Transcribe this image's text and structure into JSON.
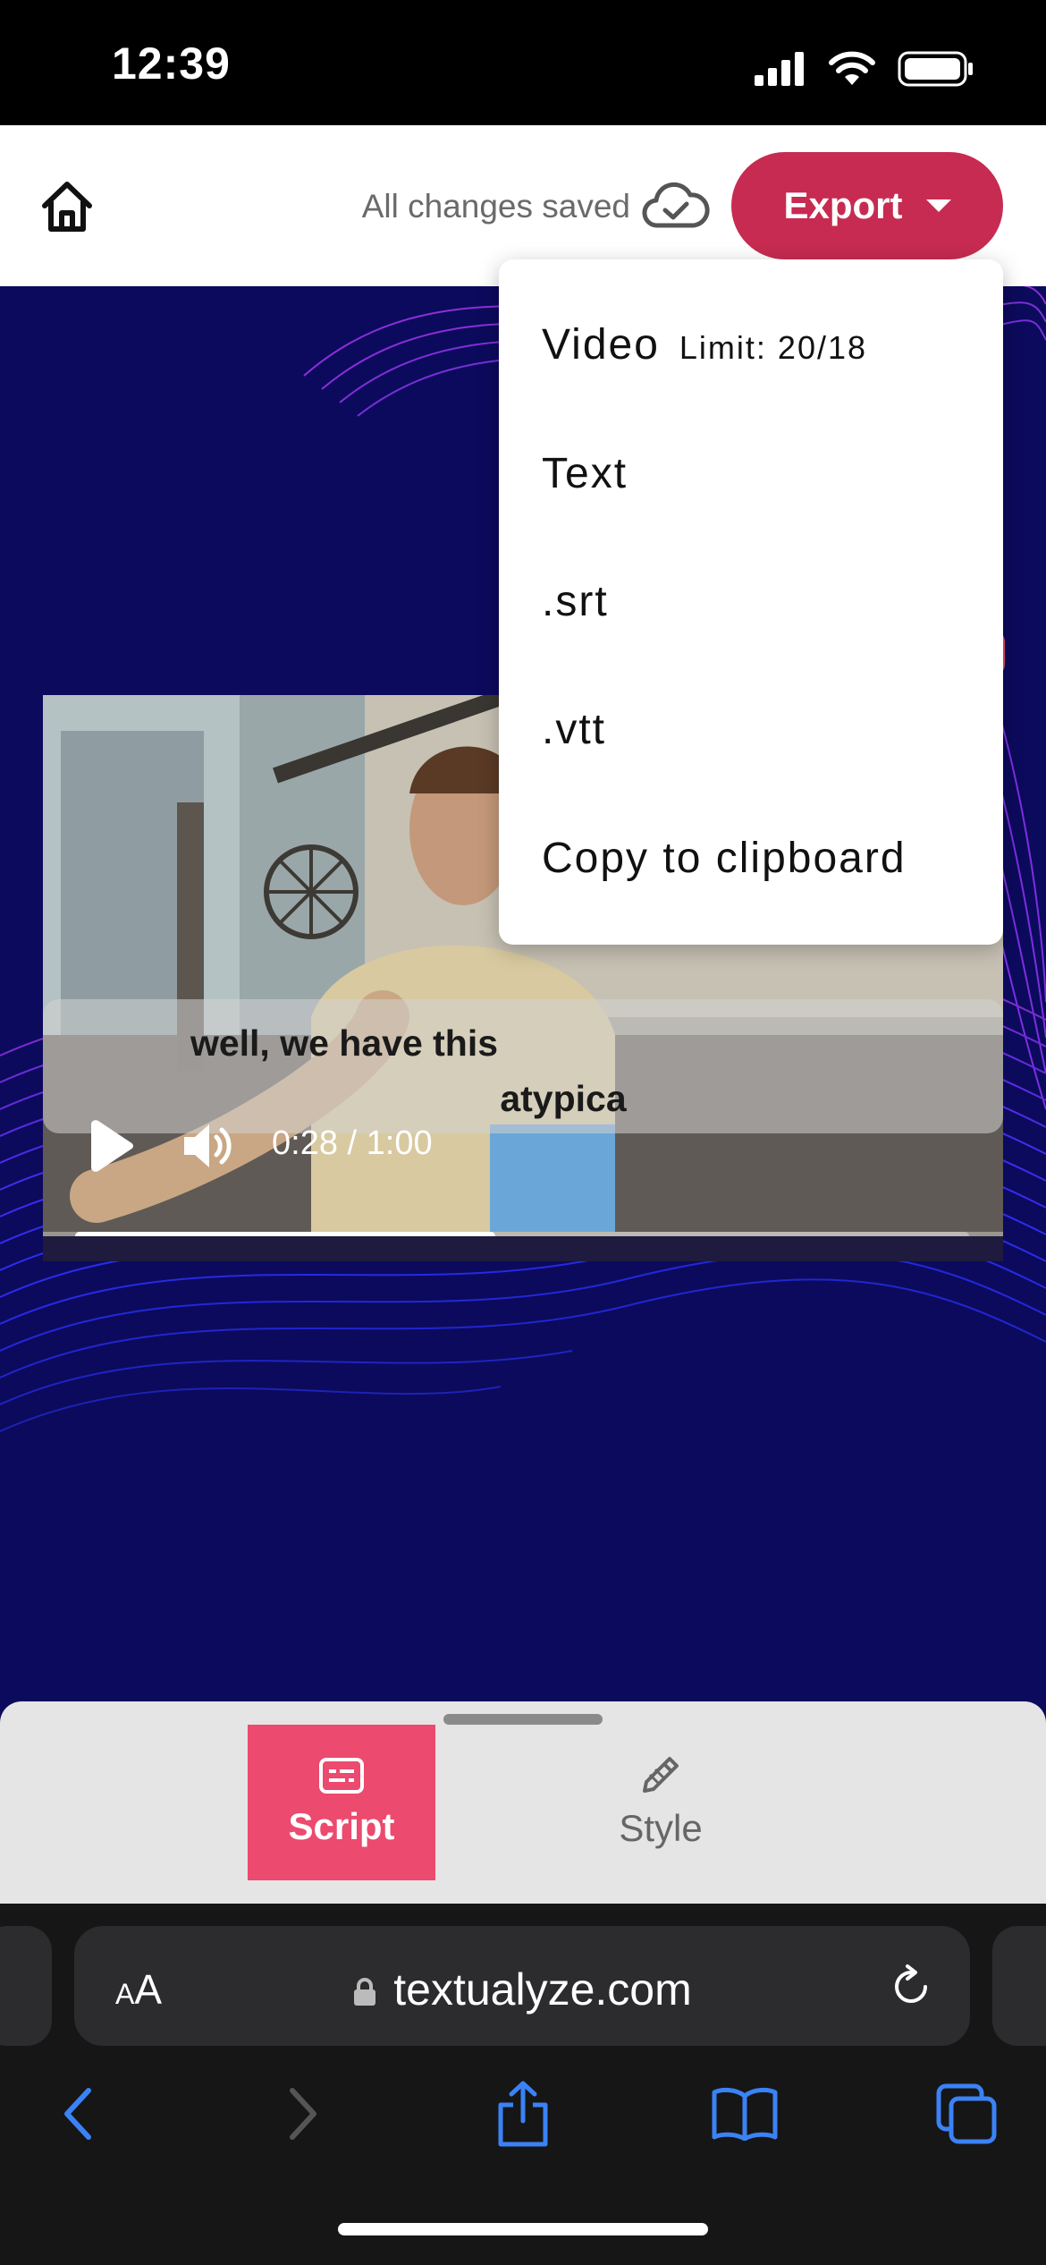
{
  "status_bar": {
    "time": "12:39"
  },
  "header": {
    "save_status": "All changes saved",
    "export_label": "Export",
    "home_icon": "home-icon",
    "cloud_icon": "cloud-check-icon",
    "accent_color": "#c72b51"
  },
  "export_menu": {
    "items": [
      {
        "label": "Video",
        "limit": "Limit: 20/18"
      },
      {
        "label": "Text"
      },
      {
        "label": ".srt"
      },
      {
        "label": ".vtt"
      },
      {
        "label": "Copy to clipboard"
      }
    ]
  },
  "video": {
    "caption_line1": "well, we have this",
    "caption_line2": "atypica",
    "time": "0:28 / 1:00",
    "progress": 0.47
  },
  "bottom_tabs": {
    "script_label": "Script",
    "style_label": "Style",
    "active": "Script",
    "active_color": "#ec4a6e"
  },
  "browser": {
    "aa_label_small": "A",
    "aa_label_large": "A",
    "url": "textualyze.com"
  }
}
